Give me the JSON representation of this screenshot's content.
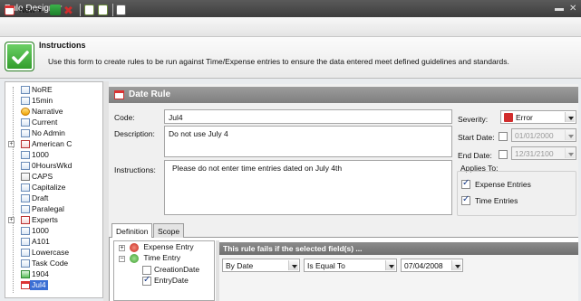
{
  "window": {
    "title": "Rule Designer",
    "minimize_glyph": "▬",
    "close_glyph": "✕"
  },
  "toolbar": {
    "new_label": "New",
    "new_dropdown_glyph": "▾",
    "icons": [
      "calendar-icon",
      "save-icon",
      "delete-icon",
      "import-icon",
      "export-icon",
      "copy-icon"
    ]
  },
  "instructions": {
    "title": "Instructions",
    "text": "Use this form to create rules to be run against Time/Expense entries to ensure the data entered meet defined guidelines and standards."
  },
  "rule_tree": {
    "items": [
      {
        "label": "NoRE",
        "icon": "document-icon"
      },
      {
        "label": "15min",
        "icon": "document-icon"
      },
      {
        "label": "Narrative",
        "icon": "warning-icon"
      },
      {
        "label": "Current",
        "icon": "document-icon"
      },
      {
        "label": "No Admin",
        "icon": "document-icon"
      },
      {
        "label": "American C",
        "icon": "checklist-icon",
        "expandable": true
      },
      {
        "label": "1000",
        "icon": "document-icon"
      },
      {
        "label": "0HoursWkd",
        "icon": "document-icon"
      },
      {
        "label": "CAPS",
        "icon": "abc-icon"
      },
      {
        "label": "Capitalize",
        "icon": "document-icon"
      },
      {
        "label": "Draft",
        "icon": "document-icon"
      },
      {
        "label": "Paralegal",
        "icon": "document-icon"
      },
      {
        "label": "Experts",
        "icon": "checklist-icon",
        "expandable": true
      },
      {
        "label": "1000",
        "icon": "document-icon"
      },
      {
        "label": "A101",
        "icon": "document-icon"
      },
      {
        "label": "Lowercase",
        "icon": "document-icon"
      },
      {
        "label": "Task Code",
        "icon": "document-icon"
      },
      {
        "label": "1904",
        "icon": "calendar-green-icon"
      },
      {
        "label": "Jul4",
        "icon": "calendar-icon",
        "selected": true
      }
    ]
  },
  "rule": {
    "header": "Date Rule",
    "code_label": "Code:",
    "code_value": "Jul4",
    "description_label": "Description:",
    "description_value": "Do not use July 4",
    "instructions_label": "Instructions:",
    "instructions_value": "Please do not enter time entries dated on July 4th",
    "severity_label": "Severity:",
    "severity_value": "Error",
    "start_date_label": "Start Date:",
    "start_date_value": "01/01/2000",
    "end_date_label": "End Date:",
    "end_date_value": "12/31/2100",
    "applies_to_label": "Applies To:",
    "applies_expense": "Expense Entries",
    "applies_time": "Time Entries",
    "colors": {
      "header_bg": "#8f8f8f",
      "selected_bg": "#3b6fd4",
      "error_red": "#d12d2d"
    }
  },
  "tabs": {
    "definition": "Definition",
    "scope": "Scope"
  },
  "field_tree": {
    "expense_entry": "Expense Entry",
    "time_entry": "Time Entry",
    "creation_date": "CreationDate",
    "entry_date": "EntryDate"
  },
  "condition": {
    "header": "This rule fails if the selected field(s) ...",
    "by_value": "By Date",
    "operator_value": "Is Equal To",
    "date_value": "07/04/2008"
  }
}
